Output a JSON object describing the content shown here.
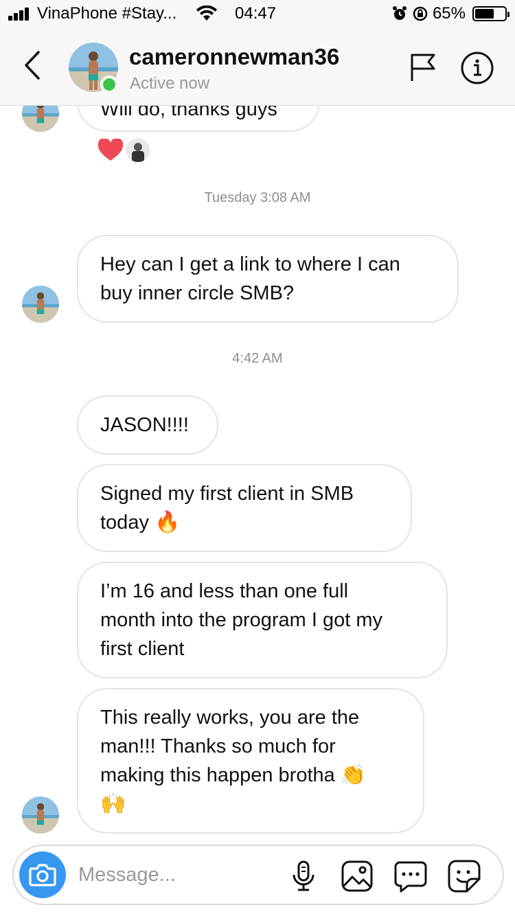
{
  "status_bar": {
    "carrier": "VinaPhone #Stay...",
    "time": "04:47",
    "battery_text": "65%",
    "battery_level": 0.65
  },
  "header": {
    "username": "cameronnewman36",
    "status": "Active now"
  },
  "timestamps": {
    "first": "Tuesday 3:08 AM",
    "second": "4:42 AM"
  },
  "messages": [
    {
      "text": "Will do, thanks guys"
    },
    {
      "text": "Hey can I get a link to where I can\nbuy inner circle SMB?"
    },
    {
      "text": "JASON!!!!"
    },
    {
      "text": "Signed my first client in SMB\ntoday ",
      "emoji": "🔥"
    },
    {
      "text": "I’m 16 and less than one full\nmonth into the program I got my\nfirst client"
    },
    {
      "text": "This really works, you are the\nman!!! Thanks so much for\nmaking this happen brotha ",
      "emoji": "👏",
      "emoji2": "🙌"
    }
  ],
  "reactions": {
    "heart": "heart-icon"
  },
  "composer": {
    "placeholder": "Message..."
  },
  "colors": {
    "accent": "#3797f0",
    "online": "#3cc34b",
    "heart": "#ed4956"
  }
}
